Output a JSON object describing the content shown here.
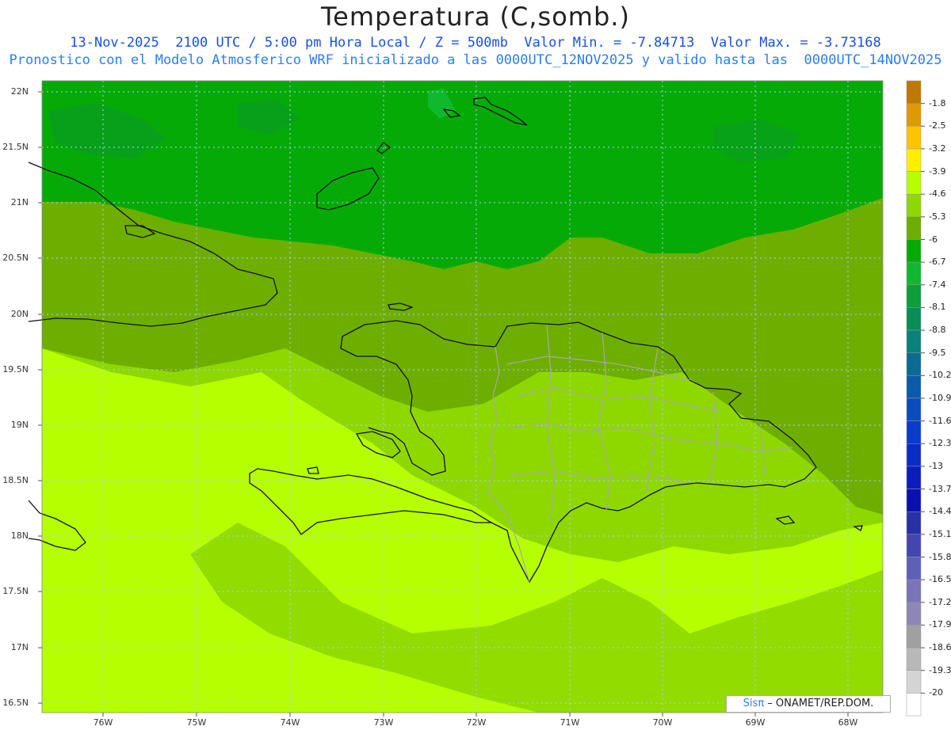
{
  "header": {
    "title": "Temperatura (C,somb.)",
    "line1": "13-Nov-2025  2100 UTC / 5:00 pm Hora Local / Z = 500mb  Valor Min. = -7.84713  Valor Max. = -3.73168",
    "line2": "Pronostico con el Modelo Atmosferico WRF inicializado a las 0000UTC_12NOV2025 y valido hasta las  0000UTC_14NOV2025"
  },
  "axes": {
    "lat_labels": [
      "22N",
      "21.5N",
      "21N",
      "20.5N",
      "20N",
      "19.5N",
      "19N",
      "18.5N",
      "18N",
      "17.5N",
      "17N",
      "16.5N"
    ],
    "lon_labels": [
      "76W",
      "75W",
      "74W",
      "73W",
      "72W",
      "71W",
      "70W",
      "69W",
      "68W"
    ]
  },
  "colorbar": {
    "labels": [
      "-1.8",
      "-2.5",
      "-3.2",
      "-3.9",
      "-4.6",
      "-5.3",
      "-6",
      "-6.7",
      "-7.4",
      "-8.1",
      "-8.8",
      "-9.5",
      "-10.2",
      "-10.9",
      "-11.6",
      "-12.3",
      "-13",
      "-13.7",
      "-14.4",
      "-15.1",
      "-15.8",
      "-16.5",
      "-17.2",
      "-17.9",
      "-18.6",
      "-19.3",
      "-20"
    ],
    "colors": [
      "#c07800",
      "#e09a00",
      "#ffc400",
      "#ffee00",
      "#b6ff00",
      "#8ed800",
      "#6eae00",
      "#06aa06",
      "#10b830",
      "#0c9e3a",
      "#0a8c58",
      "#08827a",
      "#0a6c92",
      "#0a5ca8",
      "#0a4cbe",
      "#0a3ccc",
      "#0a2cc4",
      "#0a1cbc",
      "#0a10b0",
      "#2830a8",
      "#4446b0",
      "#5e60b8",
      "#7a74b8",
      "#8e86b4",
      "#a0a0a0",
      "#b8b8b8",
      "#d4d4d4",
      "#ffffff"
    ]
  },
  "credit": {
    "sis": "Sis",
    "pi": "π",
    "rest": "– ONAMET/REP.DOM."
  }
}
